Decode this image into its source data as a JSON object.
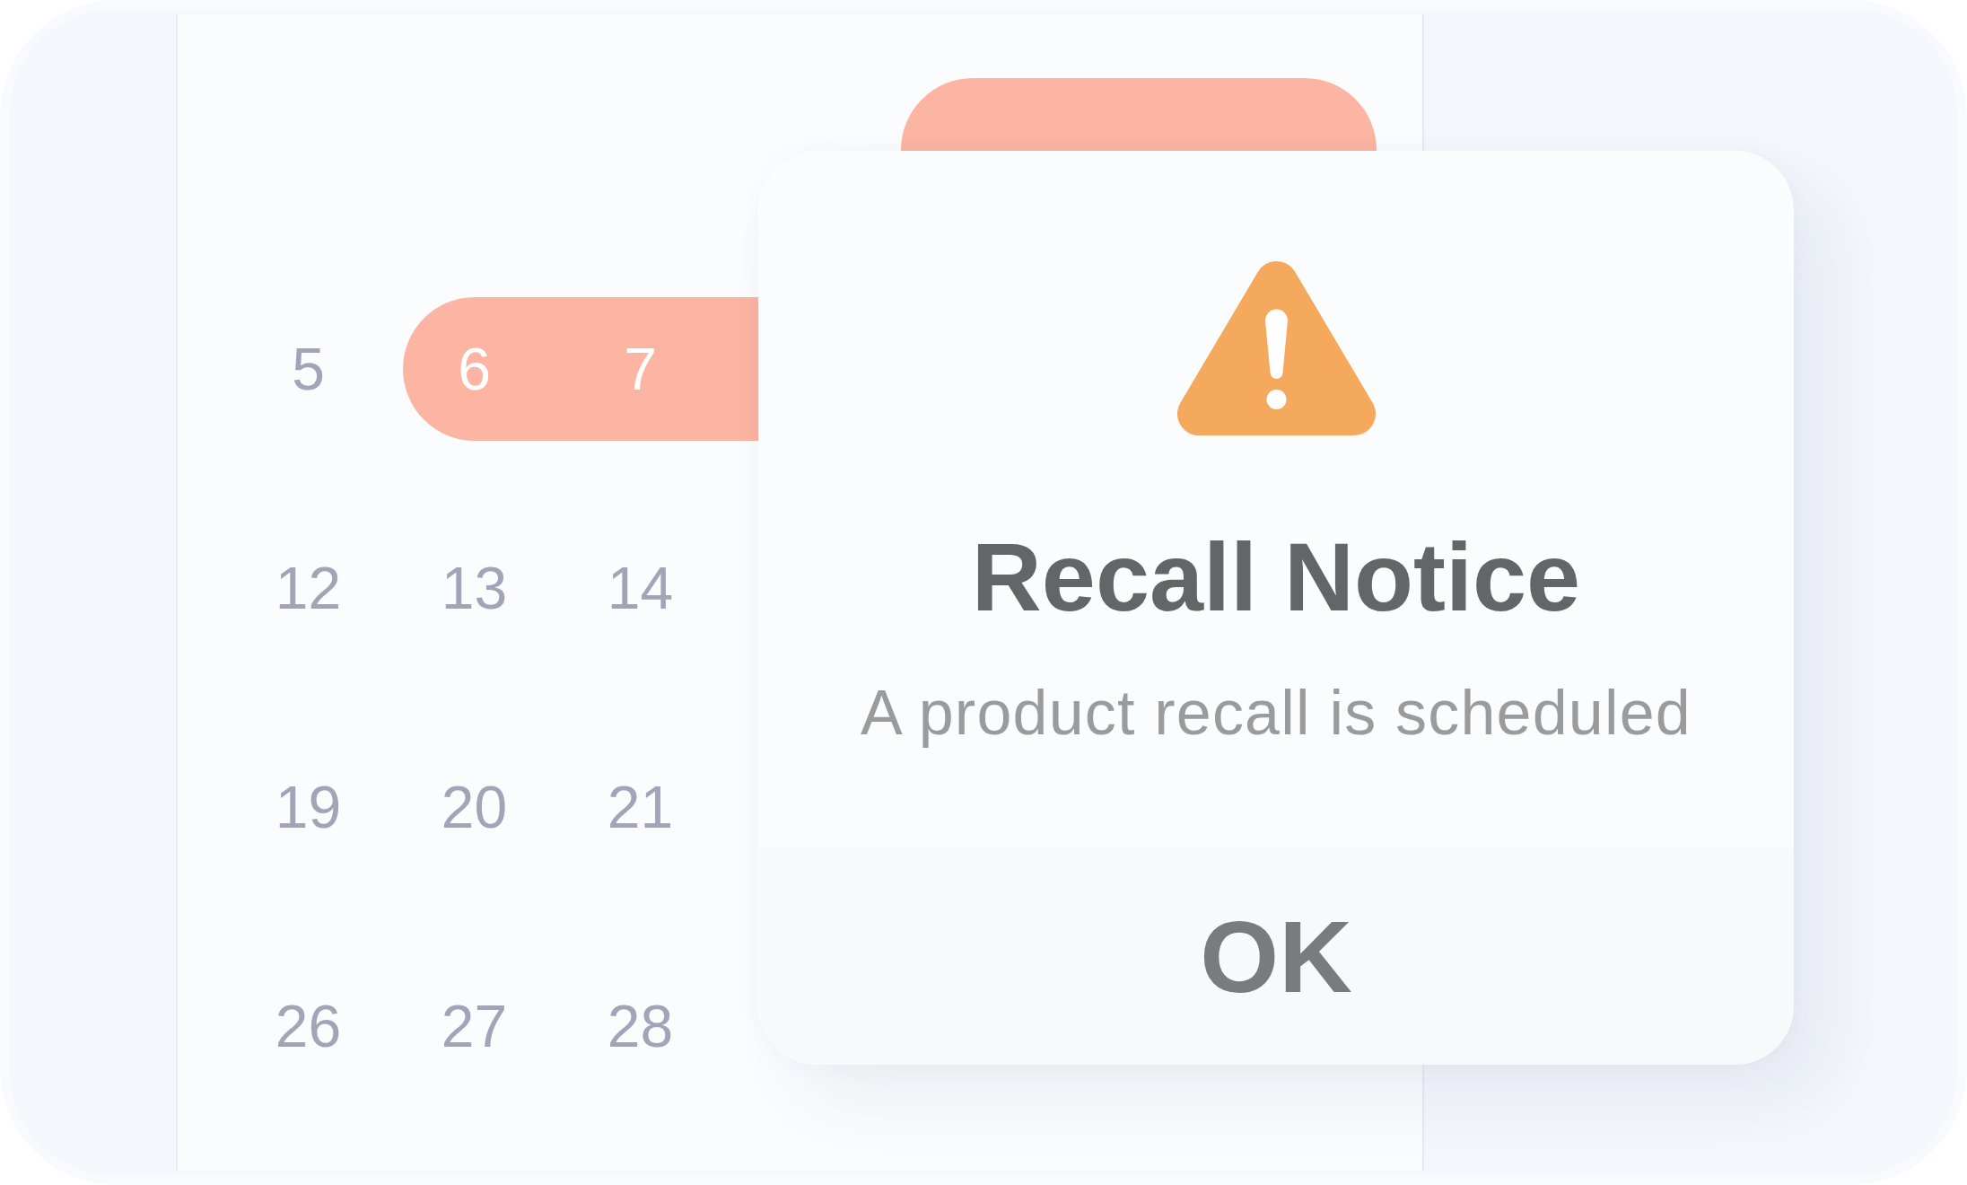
{
  "calendar": {
    "weeks": [
      {
        "days": [
          {
            "selected": true
          },
          {
            "selected": true
          },
          {
            "selected": true
          }
        ]
      },
      {
        "days": [
          {
            "label": "5",
            "selected": false
          },
          {
            "label": "6",
            "selected": true
          },
          {
            "label": "7",
            "selected": true
          }
        ]
      },
      {
        "days": [
          {
            "label": "12",
            "selected": false
          },
          {
            "label": "13",
            "selected": false
          },
          {
            "label": "14",
            "selected": false
          }
        ]
      },
      {
        "days": [
          {
            "label": "19",
            "selected": false
          },
          {
            "label": "20",
            "selected": false
          },
          {
            "label": "21",
            "selected": false
          }
        ]
      },
      {
        "days": [
          {
            "label": "26",
            "selected": false
          },
          {
            "label": "27",
            "selected": false
          },
          {
            "label": "28",
            "selected": false
          }
        ]
      }
    ]
  },
  "dialog": {
    "title": "Recall Notice",
    "message": "A product recall is scheduled",
    "button": "OK"
  }
}
